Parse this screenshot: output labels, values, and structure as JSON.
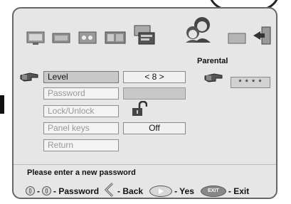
{
  "menu_icons": [
    {
      "name": "picture-icon",
      "label": ""
    },
    {
      "name": "sound-icon",
      "label": ""
    },
    {
      "name": "options-icon",
      "label": ""
    },
    {
      "name": "channels-icon",
      "label": ""
    },
    {
      "name": "teletext-icon",
      "label": ""
    },
    {
      "name": "parental-icon",
      "label": "Parental"
    },
    {
      "name": "screen-icon",
      "label": ""
    },
    {
      "name": "exit-menu-icon",
      "label": ""
    }
  ],
  "menu": {
    "items": [
      {
        "label": "Level",
        "value": "< 8 >",
        "active": true
      },
      {
        "label": "Password",
        "value": ""
      },
      {
        "label": "Lock/Unlock",
        "value": ""
      },
      {
        "label": "Panel keys",
        "value": "Off"
      },
      {
        "label": "Return",
        "value": ""
      }
    ],
    "password_mask": "* * * *"
  },
  "help": {
    "title": "Please enter a new password",
    "range_dash": "-",
    "password_text": "- Password",
    "back_text": "- Back",
    "yes_text": "- Yes",
    "exit_key_label": "EXIT",
    "exit_text": "- Exit"
  },
  "colors": {
    "screen_bg": "#e6e6e6",
    "active_field": "#c8c8c8"
  }
}
